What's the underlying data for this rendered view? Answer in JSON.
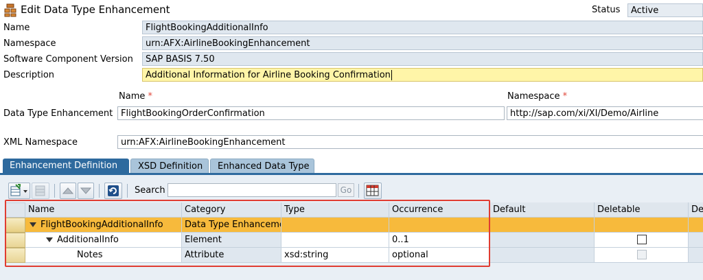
{
  "header": {
    "title": "Edit Data Type Enhancement",
    "status_label": "Status",
    "status_value": "Active"
  },
  "form": {
    "name": {
      "label": "Name",
      "value": "FlightBookingAdditionalInfo"
    },
    "namespace": {
      "label": "Namespace",
      "value": "urn:AFX:AirlineBookingEnhancement"
    },
    "swcv": {
      "label": "Software Component Version",
      "value": "SAP BASIS 7.50"
    },
    "description": {
      "label": "Description",
      "value": "Additional Information for Airline Booking Confirmation"
    }
  },
  "enhancement": {
    "name_header": "Name",
    "namespace_header": "Namespace",
    "required_mark": "*",
    "dte_label": "Data Type Enhancement",
    "dte_name": "FlightBookingOrderConfirmation",
    "dte_namespace": "http://sap.com/xi/XI/Demo/Airline",
    "xml_ns_label": "XML Namespace",
    "xml_ns_value": "urn:AFX:AirlineBookingEnhancement"
  },
  "tabs": [
    {
      "label": "Enhancement Definition",
      "active": true
    },
    {
      "label": "XSD Definition",
      "active": false
    },
    {
      "label": "Enhanced Data Type",
      "active": false
    }
  ],
  "toolbar": {
    "search_label": "Search",
    "search_value": "",
    "go_label": "Go"
  },
  "table": {
    "columns": [
      "Name",
      "Category",
      "Type",
      "Occurrence",
      "Default",
      "Deletable",
      "Def"
    ],
    "rows": [
      {
        "name": "FlightBookingAdditionalInfo",
        "category": "Data Type Enhancemer",
        "type": "",
        "occurrence": "",
        "default": "",
        "deletable": "",
        "expanded": true,
        "selected": true
      },
      {
        "name": "AdditionalInfo",
        "category": "Element",
        "type": "",
        "occurrence": "0..1",
        "default": "",
        "deletable": "checkbox",
        "expanded": true,
        "selected": false
      },
      {
        "name": "Notes",
        "category": "Attribute",
        "type": "xsd:string",
        "occurrence": "optional",
        "default": "",
        "deletable": "checkbox-disabled",
        "selected": false
      }
    ]
  },
  "colors": {
    "accent": "#2e6a9e",
    "selected_row": "#f7ba3c",
    "highlight_box": "#e03c31",
    "active_field": "#fff5a8"
  }
}
